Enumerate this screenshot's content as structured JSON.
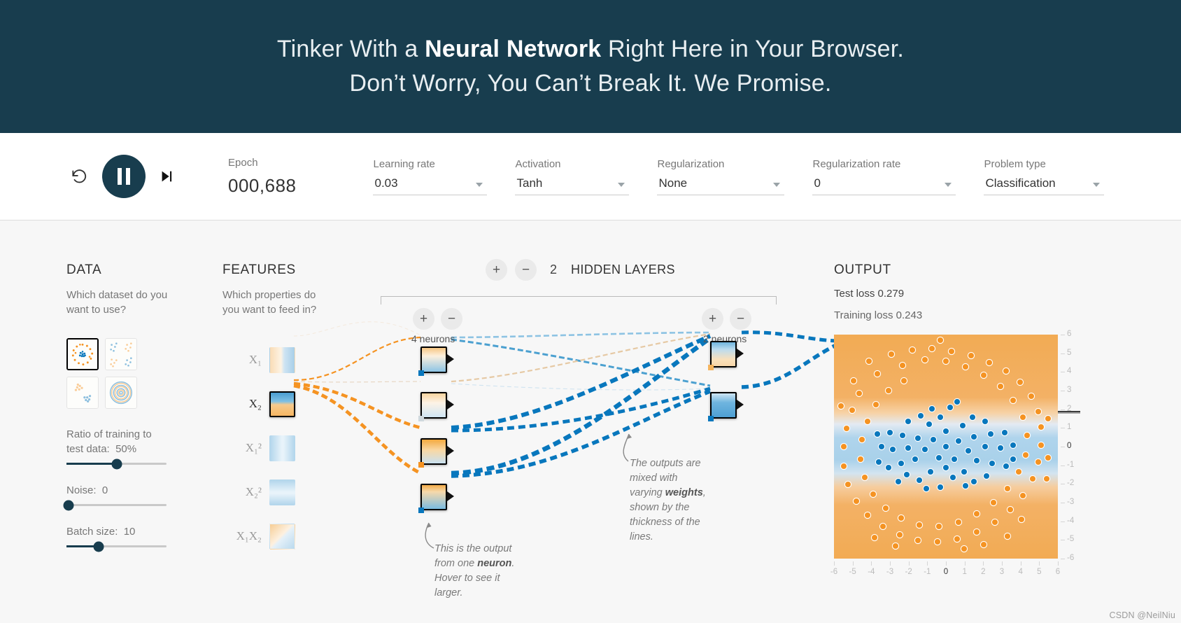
{
  "header": {
    "line1_pre": "Tinker With a ",
    "line1_bold": "Neural Network",
    "line1_post": " Right Here in Your Browser.",
    "line2": "Don’t Worry, You Can’t Break It. We Promise."
  },
  "toolbar": {
    "reset_icon": "reset-icon",
    "play_icon": "pause-icon",
    "step_icon": "step-forward-icon",
    "epoch_label": "Epoch",
    "epoch_value": "000,688",
    "controls": [
      {
        "label": "Learning rate",
        "value": "0.03"
      },
      {
        "label": "Activation",
        "value": "Tanh"
      },
      {
        "label": "Regularization",
        "value": "None"
      },
      {
        "label": "Regularization rate",
        "value": "0"
      },
      {
        "label": "Problem type",
        "value": "Classification"
      }
    ]
  },
  "data_panel": {
    "title": "DATA",
    "subtitle": "Which dataset do you want to use?",
    "datasets": [
      {
        "name": "circle",
        "selected": true
      },
      {
        "name": "exclusive-or",
        "selected": false
      },
      {
        "name": "gaussian",
        "selected": false
      },
      {
        "name": "spiral",
        "selected": false
      }
    ],
    "sliders": [
      {
        "label": "Ratio of training to test data:",
        "value": "50%",
        "pct": 50
      },
      {
        "label": "Noise:",
        "value": "0",
        "pct": 0
      },
      {
        "label": "Batch size:",
        "value": "10",
        "pct": 32
      }
    ]
  },
  "features_panel": {
    "title": "FEATURES",
    "subtitle": "Which properties do you want to feed in?",
    "features": [
      {
        "label": "X₁",
        "selected": false
      },
      {
        "label": "X₂",
        "selected": true
      },
      {
        "label": "X₁²",
        "selected": false
      },
      {
        "label": "X₂²",
        "selected": false
      },
      {
        "label": "X₁X₂",
        "selected": false
      }
    ]
  },
  "network_panel": {
    "layers_count": "2",
    "layers_text": "HIDDEN LAYERS",
    "add_layer_label": "+",
    "remove_layer_label": "−",
    "layers": [
      {
        "neuron_count_text": "4 neurons",
        "add_label": "+",
        "remove_label": "−"
      },
      {
        "neuron_count_text": "2 neurons",
        "add_label": "+",
        "remove_label": "−"
      }
    ],
    "annotation_neuron": {
      "pre": "This is the output from one ",
      "bold": "neuron",
      "post": ". Hover to see it larger."
    },
    "annotation_weights": {
      "pre": "The outputs are mixed with varying ",
      "bold": "weights",
      "post": ", shown by the thickness of the lines."
    }
  },
  "output_panel": {
    "title": "OUTPUT",
    "test_loss_label": "Test loss",
    "test_loss_value": "0.279",
    "training_loss_label": "Training loss",
    "training_loss_value": "0.243",
    "x_ticks": [
      "-6",
      "-5",
      "-4",
      "-3",
      "-2",
      "-1",
      "0",
      "1",
      "2",
      "3",
      "4",
      "5",
      "6"
    ],
    "y_ticks": [
      "6",
      "5",
      "4",
      "3",
      "2",
      "1",
      "0",
      "-1",
      "-2",
      "-3",
      "-4",
      "-5",
      "-6"
    ]
  },
  "watermark": "CSDN @NeilNiu",
  "colors": {
    "header_bg": "#183D4E",
    "accent_blue": "#0877bd",
    "accent_orange": "#f59322",
    "page_bg": "#f7f7f7"
  }
}
